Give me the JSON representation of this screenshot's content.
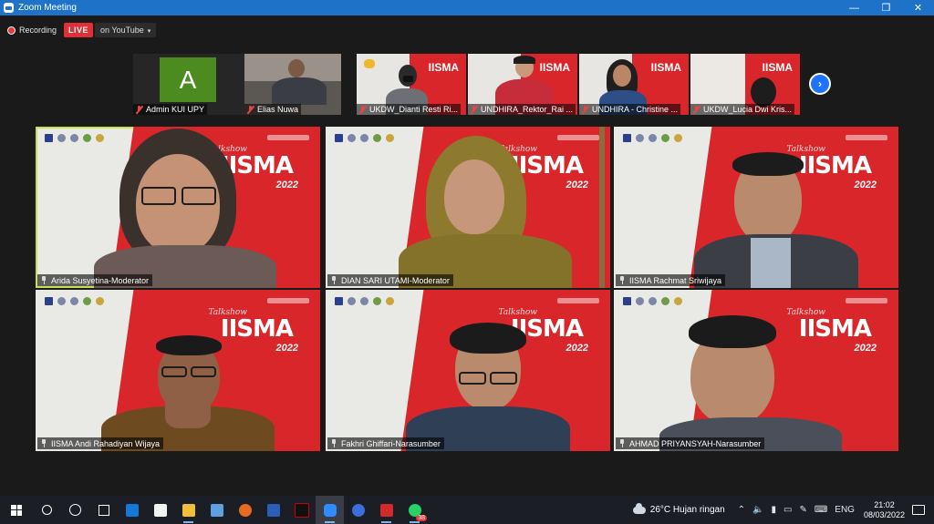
{
  "window": {
    "title": "Zoom Meeting",
    "minimize": "—",
    "maximize": "❐",
    "close": "✕"
  },
  "recording": {
    "label": "Recording",
    "live": "LIVE",
    "destination": "on YouTube",
    "caret": "▾"
  },
  "strip": {
    "participants": [
      {
        "name": "Admin KUI UPY",
        "avatar_letter": "A"
      },
      {
        "name": "Elias Nuwa"
      },
      {
        "name": "UKDW_Dianti Resti Ri..."
      },
      {
        "name": "UNDHIRA_Rektor_Rai ..."
      },
      {
        "name": "UNDHIRA - Christine ..."
      },
      {
        "name": "UKDW_Lucia Dwi Kris..."
      }
    ],
    "next_label": "›"
  },
  "tiles": [
    {
      "name": "Arida Susyetina-Moderator",
      "active": true
    },
    {
      "name": "DIAN SARI UTAMI-Moderator"
    },
    {
      "name": "IISMA Rachmat Sriwijaya"
    },
    {
      "name": "IISMA Andi Rahadiyan Wijaya"
    },
    {
      "name": "Fakhri Ghiffari-Narasumber"
    },
    {
      "name": "AHMAD PRIYANSYAH-Narasumber"
    }
  ],
  "backdrop": {
    "brand": "IISMA",
    "talkshow": "Talkshow",
    "year": "2022"
  },
  "colors": {
    "titlebar": "#1e73c8",
    "live": "#e02f36",
    "backdrop_red": "#d8262b",
    "active_border": "#c7e04d"
  },
  "taskbar": {
    "weather_temp": "26°C",
    "weather_desc": "Hujan ringan",
    "lang": "ENG",
    "time": "21:02",
    "date": "08/03/2022",
    "badge": "38",
    "icons": [
      "windows-icon",
      "search-icon",
      "cortana-icon",
      "taskview-icon",
      "mail-icon",
      "store-icon",
      "file-explorer-icon",
      "onedrive-icon",
      "firefox-icon",
      "word-icon",
      "netflix-icon",
      "zoom-icon",
      "edge-icon",
      "media-icon",
      "whatsapp-icon"
    ]
  }
}
